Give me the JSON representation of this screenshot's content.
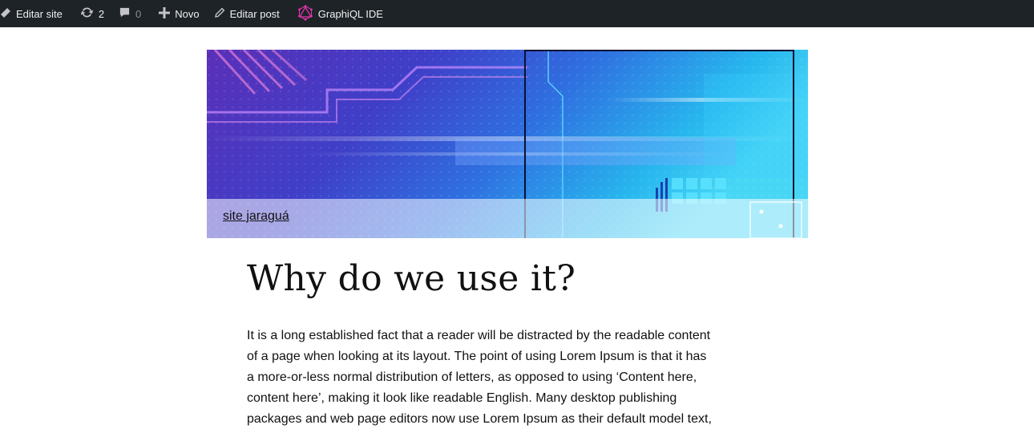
{
  "admin_bar": {
    "items": [
      {
        "id": "edit-site",
        "icon": "paintbrush-icon",
        "label": "Editar site"
      },
      {
        "id": "updates",
        "icon": "updates-icon",
        "label": "2"
      },
      {
        "id": "comments",
        "icon": "comment-icon",
        "label": "0"
      },
      {
        "id": "new",
        "icon": "plus-icon",
        "label": "Novo"
      },
      {
        "id": "edit-post",
        "icon": "pencil-icon",
        "label": "Editar post"
      },
      {
        "id": "graphiql",
        "icon": "graphql-icon",
        "label": "GraphiQL IDE"
      }
    ],
    "colors": {
      "background": "#1d2327",
      "text": "#f0f0f1",
      "graphql_pink": "#e535ab",
      "muted": "#8c8f94"
    }
  },
  "header": {
    "site_title": "site jaraguá"
  },
  "post": {
    "title": "Why do we use it?",
    "body_lines": [
      "It is a long established fact that a reader will be distracted by the readable content",
      "of a page when looking at its layout. The point of using Lorem Ipsum is that it has",
      "a more-or-less normal distribution of letters, as opposed to using ‘Content here,",
      "content here’, making it look like readable English. Many desktop publishing",
      "packages and web page editors now use Lorem Ipsum as their default model text,"
    ]
  }
}
